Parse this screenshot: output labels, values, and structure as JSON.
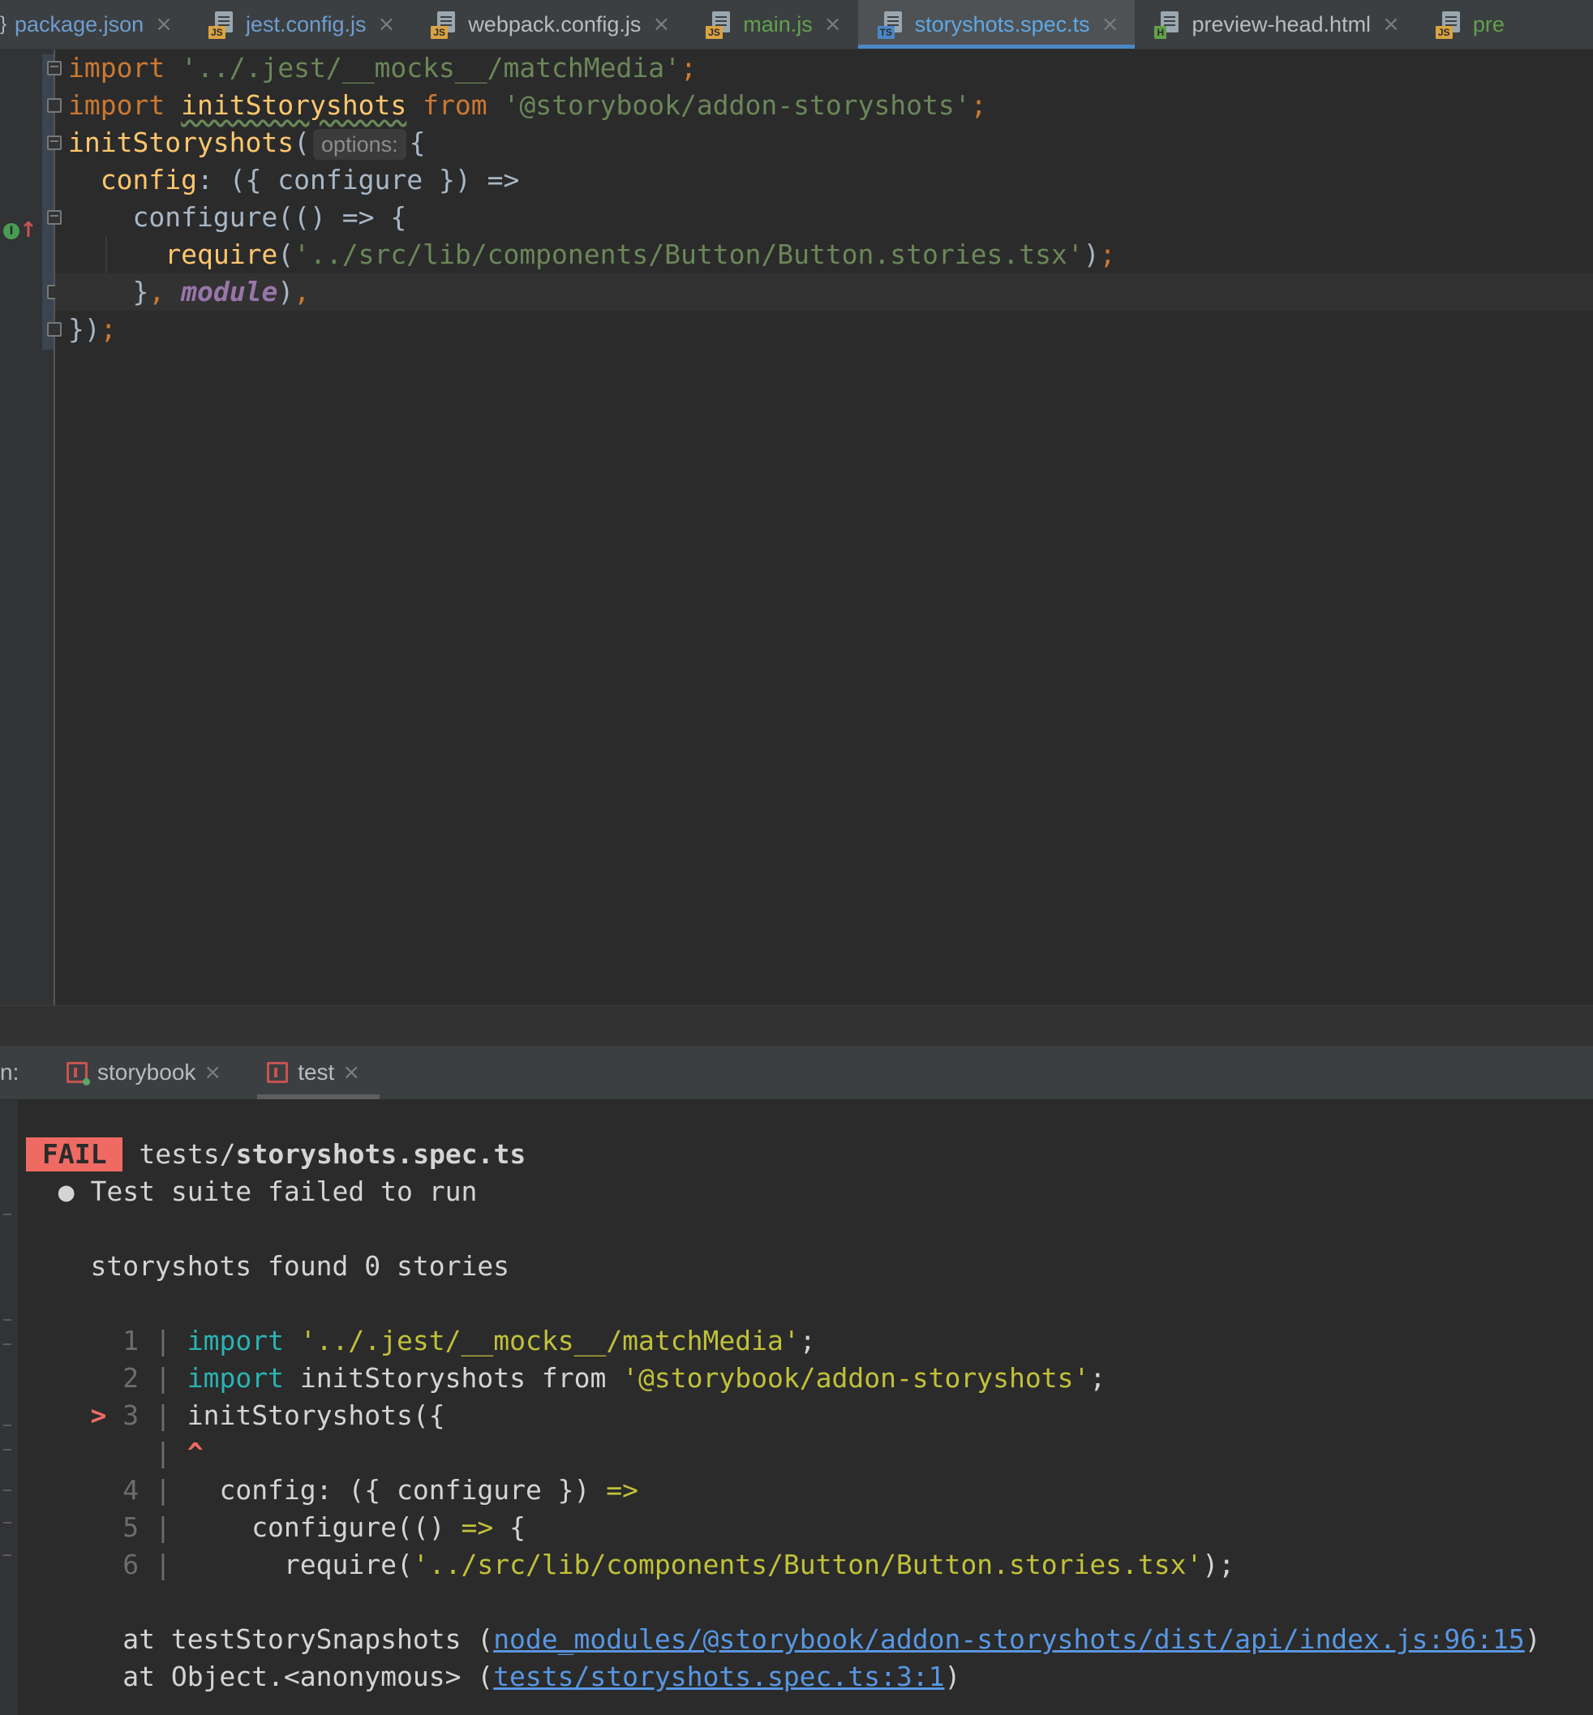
{
  "editor_tabs": [
    {
      "label": "package.json",
      "icon": "json-file-icon",
      "badge": "",
      "color": "blue"
    },
    {
      "label": "jest.config.js",
      "icon": "js-file-icon",
      "badge": "JS",
      "color": "blue"
    },
    {
      "label": "webpack.config.js",
      "icon": "js-file-icon",
      "badge": "JS",
      "color": "plain"
    },
    {
      "label": "main.js",
      "icon": "js-file-icon",
      "badge": "JS",
      "color": "green"
    },
    {
      "label": "storyshots.spec.ts",
      "icon": "ts-file-icon",
      "badge": "TS",
      "color": "active"
    },
    {
      "label": "preview-head.html",
      "icon": "html-file-icon",
      "badge": "H",
      "color": "plain"
    },
    {
      "label": "pre",
      "icon": "js-file-icon",
      "badge": "JS",
      "color": "green"
    }
  ],
  "editor": {
    "line1": {
      "kw": "import",
      "str": "'../.jest/__mocks__/matchMedia'",
      "end": ";"
    },
    "line2": {
      "kw": "import",
      "ident": "initStoryshots",
      "from": "from",
      "str": "'@storybook/addon-storyshots'",
      "end": ";"
    },
    "line3": {
      "fn": "initStoryshots",
      "open": "(",
      "hint": "options:",
      "brace": "{"
    },
    "line4": {
      "key": "config",
      "rest": ": ({ configure }) =>"
    },
    "line5": {
      "text": "configure(() => {"
    },
    "line6": {
      "fn": "require",
      "open": "(",
      "str": "'../src/lib/components/Button/Button.stories.tsx'",
      "close": ")",
      "end": ";"
    },
    "line7": {
      "close": "}",
      "comma": ",",
      "mod": "module",
      "paren": ")",
      "end": ","
    },
    "line8": {
      "text": "})",
      "end": ";"
    }
  },
  "run_panel": {
    "prefix": "n:",
    "tabs": [
      {
        "label": "storybook"
      },
      {
        "label": "test"
      }
    ]
  },
  "console": {
    "fail_badge": "FAIL",
    "file_dir": "tests/",
    "file_name": "storyshots.spec.ts",
    "bullet_line": "● Test suite failed to run",
    "message": "storyshots found 0 stories",
    "snippet": [
      {
        "marker": "  ",
        "num": "1",
        "kw": "import",
        "mid": " ",
        "str": "'../.jest/__mocks__/matchMedia'",
        "rest": ";"
      },
      {
        "marker": "  ",
        "num": "2",
        "kw": "import",
        "mid": " initStoryshots from ",
        "str": "'@storybook/addon-storyshots'",
        "rest": ";"
      },
      {
        "marker": "> ",
        "num": "3",
        "kw": "",
        "mid": "initStoryshots({",
        "str": "",
        "rest": ""
      }
    ],
    "caret": "^",
    "snippet2": [
      {
        "num": "4",
        "pre": "  config: ({ configure }) ",
        "arrow": "=>",
        "str": "",
        "post": ""
      },
      {
        "num": "5",
        "pre": "    configure(() ",
        "arrow": "=>",
        "str": "",
        "post": " {"
      },
      {
        "num": "6",
        "pre": "      require(",
        "arrow": "",
        "str": "'../src/lib/components/Button/Button.stories.tsx'",
        "post": ");"
      }
    ],
    "stack": [
      {
        "prefix": "at testStorySnapshots (",
        "link": "node_modules/@storybook/addon-storyshots/dist/api/index.js:96:15",
        "suffix": ")"
      },
      {
        "prefix": "at Object.<anonymous> (",
        "link": "tests/storyshots.spec.ts:3:1",
        "suffix": ")"
      }
    ]
  },
  "colors": {
    "accent": "#4a88c7",
    "fail": "#ef6a63",
    "keyword": "#cc7832",
    "string": "#6a8759",
    "function": "#ffc66d"
  }
}
